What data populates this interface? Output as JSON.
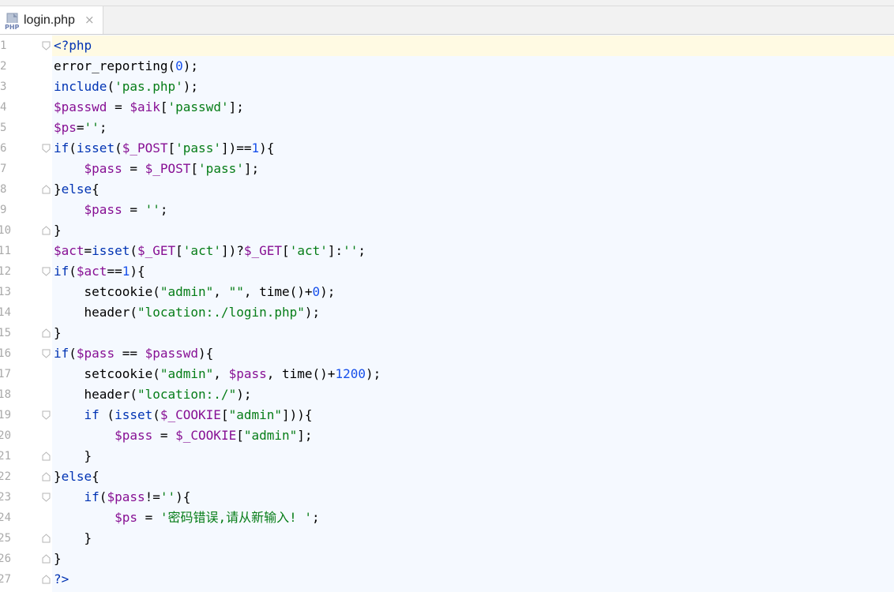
{
  "tab": {
    "icon": "php-file-icon",
    "label": "login.php",
    "close": "×"
  },
  "editor": {
    "current_line": 1,
    "lines": [
      {
        "n": "1",
        "fold": "open",
        "t": [
          [
            "k",
            "<?php"
          ]
        ]
      },
      {
        "n": "2",
        "t": [
          [
            "f",
            "error_reporting("
          ],
          [
            "n",
            "0"
          ],
          [
            "p",
            ");"
          ]
        ]
      },
      {
        "n": "3",
        "t": [
          [
            "k",
            "include"
          ],
          [
            "p",
            "("
          ],
          [
            "s",
            "'pas.php'"
          ],
          [
            "p",
            ");"
          ]
        ]
      },
      {
        "n": "4",
        "t": [
          [
            "v",
            "$passwd"
          ],
          [
            "p",
            " = "
          ],
          [
            "v",
            "$aik"
          ],
          [
            "p",
            "["
          ],
          [
            "s",
            "'passwd'"
          ],
          [
            "p",
            "];"
          ]
        ]
      },
      {
        "n": "5",
        "t": [
          [
            "v",
            "$ps"
          ],
          [
            "p",
            "="
          ],
          [
            "s",
            "''"
          ],
          [
            "p",
            ";"
          ]
        ]
      },
      {
        "n": "6",
        "fold": "open",
        "t": [
          [
            "k",
            "if"
          ],
          [
            "p",
            "("
          ],
          [
            "k",
            "isset"
          ],
          [
            "p",
            "("
          ],
          [
            "v",
            "$_POST"
          ],
          [
            "p",
            "["
          ],
          [
            "s",
            "'pass'"
          ],
          [
            "p",
            "])=="
          ],
          [
            "n",
            "1"
          ],
          [
            "p",
            "){"
          ]
        ]
      },
      {
        "n": "7",
        "t": [
          [
            "p",
            "    "
          ],
          [
            "v",
            "$pass"
          ],
          [
            "p",
            " = "
          ],
          [
            "v",
            "$_POST"
          ],
          [
            "p",
            "["
          ],
          [
            "s",
            "'pass'"
          ],
          [
            "p",
            "];"
          ]
        ]
      },
      {
        "n": "8",
        "fold": "close",
        "t": [
          [
            "p",
            "}"
          ],
          [
            "k",
            "else"
          ],
          [
            "p",
            "{"
          ]
        ]
      },
      {
        "n": "9",
        "t": [
          [
            "p",
            "    "
          ],
          [
            "v",
            "$pass"
          ],
          [
            "p",
            " = "
          ],
          [
            "s",
            "''"
          ],
          [
            "p",
            ";"
          ]
        ]
      },
      {
        "n": "10",
        "fold": "close",
        "t": [
          [
            "p",
            "}"
          ]
        ]
      },
      {
        "n": "11",
        "t": [
          [
            "v",
            "$act"
          ],
          [
            "p",
            "="
          ],
          [
            "k",
            "isset"
          ],
          [
            "p",
            "("
          ],
          [
            "v",
            "$_GET"
          ],
          [
            "p",
            "["
          ],
          [
            "s",
            "'act'"
          ],
          [
            "p",
            "])?"
          ],
          [
            "v",
            "$_GET"
          ],
          [
            "p",
            "["
          ],
          [
            "s",
            "'act'"
          ],
          [
            "p",
            "]:"
          ],
          [
            "s",
            "''"
          ],
          [
            "p",
            ";"
          ]
        ]
      },
      {
        "n": "12",
        "fold": "open",
        "t": [
          [
            "k",
            "if"
          ],
          [
            "p",
            "("
          ],
          [
            "v",
            "$act"
          ],
          [
            "p",
            "=="
          ],
          [
            "n",
            "1"
          ],
          [
            "p",
            "){"
          ]
        ]
      },
      {
        "n": "13",
        "t": [
          [
            "p",
            "    "
          ],
          [
            "f",
            "setcookie("
          ],
          [
            "s",
            "\"admin\""
          ],
          [
            "p",
            ", "
          ],
          [
            "s",
            "\"\""
          ],
          [
            "p",
            ", "
          ],
          [
            "f",
            "time()"
          ],
          [
            "p",
            "+"
          ],
          [
            "n",
            "0"
          ],
          [
            "p",
            ");"
          ]
        ]
      },
      {
        "n": "14",
        "t": [
          [
            "p",
            "    "
          ],
          [
            "f",
            "header("
          ],
          [
            "s",
            "\"location:./login.php\""
          ],
          [
            "p",
            ");"
          ]
        ]
      },
      {
        "n": "15",
        "fold": "close",
        "t": [
          [
            "p",
            "}"
          ]
        ]
      },
      {
        "n": "16",
        "fold": "open",
        "t": [
          [
            "k",
            "if"
          ],
          [
            "p",
            "("
          ],
          [
            "v",
            "$pass"
          ],
          [
            "p",
            " == "
          ],
          [
            "v",
            "$passwd"
          ],
          [
            "p",
            "){"
          ]
        ]
      },
      {
        "n": "17",
        "t": [
          [
            "p",
            "    "
          ],
          [
            "f",
            "setcookie("
          ],
          [
            "s",
            "\"admin\""
          ],
          [
            "p",
            ", "
          ],
          [
            "v",
            "$pass"
          ],
          [
            "p",
            ", "
          ],
          [
            "f",
            "time()"
          ],
          [
            "p",
            "+"
          ],
          [
            "n",
            "1200"
          ],
          [
            "p",
            ");"
          ]
        ]
      },
      {
        "n": "18",
        "t": [
          [
            "p",
            "    "
          ],
          [
            "f",
            "header("
          ],
          [
            "s",
            "\"location:./\""
          ],
          [
            "p",
            ");"
          ]
        ]
      },
      {
        "n": "19",
        "fold": "open",
        "t": [
          [
            "p",
            "    "
          ],
          [
            "k",
            "if"
          ],
          [
            "p",
            " ("
          ],
          [
            "k",
            "isset"
          ],
          [
            "p",
            "("
          ],
          [
            "v",
            "$_COOKIE"
          ],
          [
            "p",
            "["
          ],
          [
            "s",
            "\"admin\""
          ],
          [
            "p",
            "])){"
          ]
        ]
      },
      {
        "n": "20",
        "t": [
          [
            "p",
            "        "
          ],
          [
            "v",
            "$pass"
          ],
          [
            "p",
            " = "
          ],
          [
            "v",
            "$_COOKIE"
          ],
          [
            "p",
            "["
          ],
          [
            "s",
            "\"admin\""
          ],
          [
            "p",
            "];"
          ]
        ]
      },
      {
        "n": "21",
        "fold": "close",
        "t": [
          [
            "p",
            "    }"
          ]
        ]
      },
      {
        "n": "22",
        "fold": "close",
        "t": [
          [
            "p",
            "}"
          ],
          [
            "k",
            "else"
          ],
          [
            "p",
            "{"
          ]
        ]
      },
      {
        "n": "23",
        "fold": "open",
        "t": [
          [
            "p",
            "    "
          ],
          [
            "k",
            "if"
          ],
          [
            "p",
            "("
          ],
          [
            "v",
            "$pass"
          ],
          [
            "p",
            "!="
          ],
          [
            "s",
            "''"
          ],
          [
            "p",
            "){"
          ]
        ]
      },
      {
        "n": "24",
        "t": [
          [
            "p",
            "        "
          ],
          [
            "v",
            "$ps"
          ],
          [
            "p",
            " = "
          ],
          [
            "s",
            "'密码错误,请从新输入! '"
          ],
          [
            "p",
            ";"
          ]
        ]
      },
      {
        "n": "25",
        "fold": "close",
        "t": [
          [
            "p",
            "    }"
          ]
        ]
      },
      {
        "n": "26",
        "fold": "close",
        "t": [
          [
            "p",
            "}"
          ]
        ]
      },
      {
        "n": "27",
        "fold": "close",
        "t": [
          [
            "k",
            "?>"
          ]
        ]
      }
    ]
  }
}
